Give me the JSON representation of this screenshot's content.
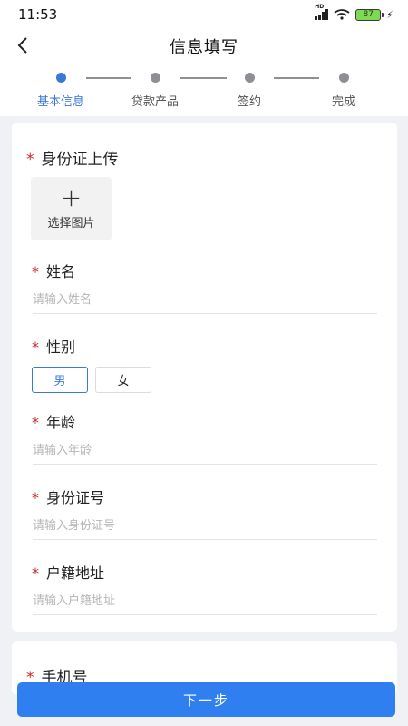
{
  "status_bar": {
    "time": "11:53",
    "network": "HD",
    "battery": "87"
  },
  "nav": {
    "title": "信息填写",
    "back_icon": "chevron-left-icon"
  },
  "steps": [
    {
      "label": "基本信息",
      "active": true
    },
    {
      "label": "贷款产品",
      "active": false
    },
    {
      "label": "签约",
      "active": false
    },
    {
      "label": "完成",
      "active": false
    }
  ],
  "form": {
    "required_mark": "*",
    "id_upload": {
      "label": "身份证上传",
      "button_plus": "+",
      "button_text": "选择图片"
    },
    "name": {
      "label": "姓名",
      "placeholder": "请输入姓名",
      "value": ""
    },
    "gender": {
      "label": "性别",
      "options": [
        "男",
        "女"
      ],
      "selected": "男"
    },
    "age": {
      "label": "年龄",
      "placeholder": "请输入年龄",
      "value": ""
    },
    "id_number": {
      "label": "身份证号",
      "placeholder": "请输入身份证号",
      "value": ""
    },
    "household": {
      "label": "户籍地址",
      "placeholder": "请输入户籍地址",
      "value": ""
    },
    "phone": {
      "label": "手机号"
    }
  },
  "footer": {
    "next_label": "下一步"
  },
  "colors": {
    "accent": "#2f7ff0",
    "required": "#c62828",
    "background": "#f0f1f4"
  }
}
